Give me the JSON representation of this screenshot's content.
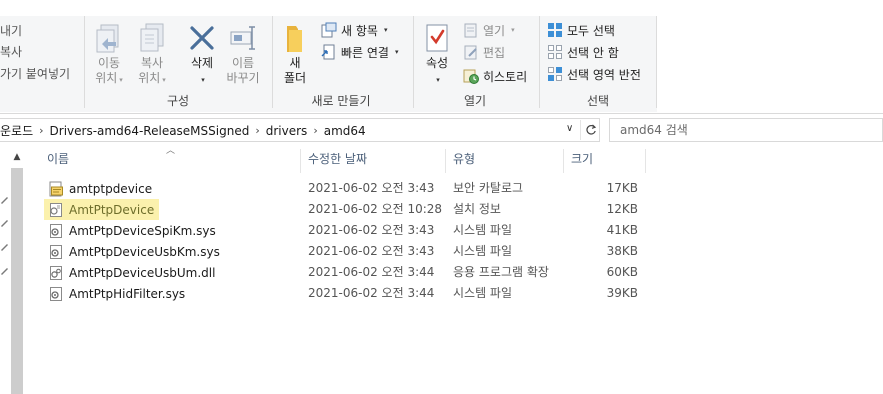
{
  "ribbon": {
    "clipboard": {
      "cut_partial": "내기",
      "copy_path_partial": "복사",
      "paste_shortcut_partial": "가기 붙여넣기"
    },
    "organize": {
      "label": "구성",
      "move_to": [
        "이동",
        "위치"
      ],
      "copy_to": [
        "복사",
        "위치"
      ],
      "delete": "삭제",
      "rename": [
        "이름",
        "바꾸기"
      ]
    },
    "new": {
      "label": "새로 만들기",
      "new_folder": [
        "새",
        "폴더"
      ],
      "new_item": "새 항목",
      "easy_access": "빠른 연결"
    },
    "open": {
      "label": "열기",
      "properties": "속성",
      "open": "열기",
      "edit": "편집",
      "history": "히스토리"
    },
    "select": {
      "label": "선택",
      "select_all": "모두 선택",
      "select_none": "선택 안 함",
      "invert": "선택 영역 반전"
    }
  },
  "address": {
    "crumbs": [
      "운로드",
      "Drivers-amd64-ReleaseMSSigned",
      "drivers",
      "amd64"
    ],
    "search_placeholder": "amd64 검색"
  },
  "columns": {
    "name": "이름",
    "date": "수정한 날짜",
    "type": "유형",
    "size": "크기"
  },
  "files": [
    {
      "name": "amtptpdevice",
      "date": "2021-06-02 오전 3:43",
      "type": "보안 카탈로그",
      "size": "17KB",
      "icon": "security-catalog-icon",
      "selected": false
    },
    {
      "name": "AmtPtpDevice",
      "date": "2021-06-02 오전 10:28",
      "type": "설치 정보",
      "size": "12KB",
      "icon": "setup-information-icon",
      "selected": true
    },
    {
      "name": "AmtPtpDeviceSpiKm.sys",
      "date": "2021-06-02 오전 3:43",
      "type": "시스템 파일",
      "size": "41KB",
      "icon": "system-file-icon",
      "selected": false
    },
    {
      "name": "AmtPtpDeviceUsbKm.sys",
      "date": "2021-06-02 오전 3:43",
      "type": "시스템 파일",
      "size": "38KB",
      "icon": "system-file-icon",
      "selected": false
    },
    {
      "name": "AmtPtpDeviceUsbUm.dll",
      "date": "2021-06-02 오전 3:44",
      "type": "응용 프로그램 확장",
      "size": "60KB",
      "icon": "dll-file-icon",
      "selected": false
    },
    {
      "name": "AmtPtpHidFilter.sys",
      "date": "2021-06-02 오전 3:44",
      "type": "시스템 파일",
      "size": "39KB",
      "icon": "system-file-icon",
      "selected": false
    }
  ],
  "colors": {
    "selection": "#fbf1ad",
    "header_text": "#4c607a",
    "accent_blue": "#2b79d0"
  }
}
